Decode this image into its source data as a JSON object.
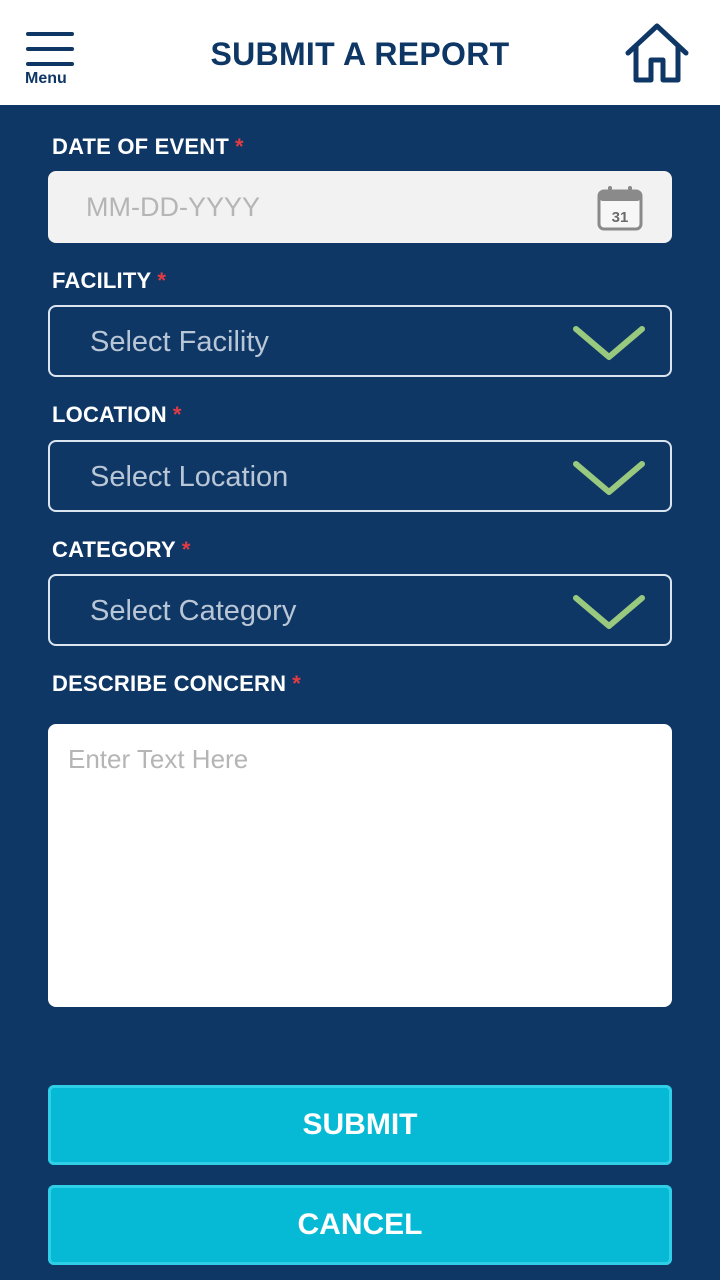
{
  "header": {
    "menu_label": "Menu",
    "title": "SUBMIT A REPORT",
    "menu_icon": "hamburger-menu-icon",
    "home_icon": "home-icon"
  },
  "form": {
    "date": {
      "label": "DATE OF EVENT",
      "required_mark": "*",
      "placeholder": "MM-DD-YYYY",
      "value": "",
      "calendar_icon": "calendar-icon",
      "calendar_day": "31"
    },
    "facility": {
      "label": "FACILITY",
      "required_mark": "*",
      "placeholder": "Select Facility",
      "icon": "chevron-down-icon"
    },
    "location": {
      "label": "LOCATION",
      "required_mark": "*",
      "placeholder": "Select Location",
      "icon": "chevron-down-icon"
    },
    "category": {
      "label": "CATEGORY",
      "required_mark": "*",
      "placeholder": "Select Category",
      "icon": "chevron-down-icon"
    },
    "concern": {
      "label": "DESCRIBE CONCERN",
      "required_mark": "*",
      "placeholder": "Enter Text Here",
      "value": ""
    }
  },
  "actions": {
    "submit_label": "SUBMIT",
    "cancel_label": "CANCEL"
  },
  "colors": {
    "background": "#0f3766",
    "header_background": "#ffffff",
    "button": "#06bad6",
    "required": "#e23b42",
    "chevron": "#98c97e"
  }
}
